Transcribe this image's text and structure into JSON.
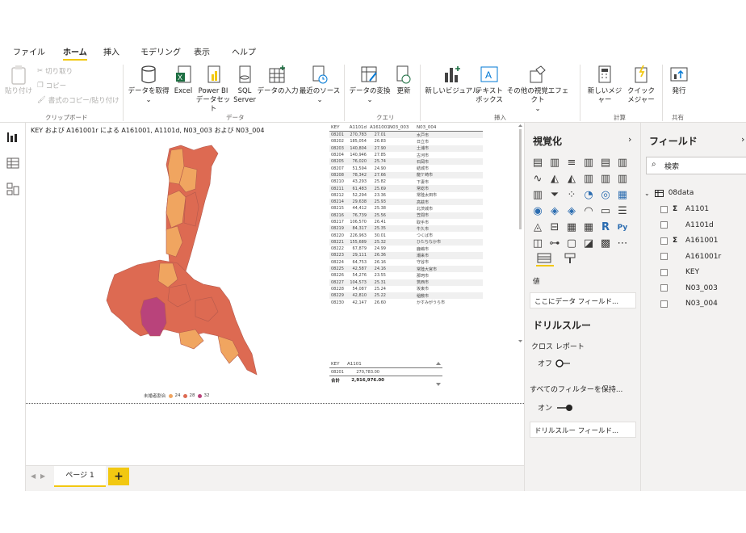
{
  "tabs": [
    "ファイル",
    "ホーム",
    "挿入",
    "モデリング",
    "表示",
    "ヘルプ"
  ],
  "active_tab": "ホーム",
  "ribbon": {
    "clipboard": {
      "paste": "貼り付け",
      "cut": "切り取り",
      "copy": "コピー",
      "format_painter": "書式のコピー/貼り付け",
      "group": "クリップボード"
    },
    "data": {
      "get_data": "データを取得",
      "excel": "Excel",
      "powerbi": "Power BI データセット",
      "sql": "SQL Server",
      "enter_data": "データの入力",
      "recent": "最近のソース",
      "group": "データ"
    },
    "queries": {
      "transform": "データの変換",
      "refresh": "更新",
      "group": "クエリ"
    },
    "insert": {
      "new_visual": "新しいビジュアル",
      "textbox": "テキスト ボックス",
      "more_visuals": "その他の視覚エフェクト",
      "group": "挿入"
    },
    "calc": {
      "new_measure": "新しいメジャー",
      "quick_measure": "クイック メジャー",
      "group": "計算"
    },
    "share": {
      "publish": "発行",
      "group": "共有"
    }
  },
  "visual_title": "KEY および A161001r による A161001, A1101d, N03_003 および N03_004",
  "legend": {
    "title": "未婚者割合",
    "items": [
      {
        "label": "24",
        "color": "#f0a560"
      },
      {
        "label": "28",
        "color": "#dd6a52"
      },
      {
        "label": "32",
        "color": "#b9437b"
      }
    ]
  },
  "table1": {
    "headers": [
      "KEY",
      "A1101d",
      "A161001",
      "N03_003",
      "N03_004"
    ],
    "rows": [
      [
        "08201",
        "270,783",
        "27.01",
        "",
        "水戸市"
      ],
      [
        "08202",
        "185,054",
        "26.83",
        "",
        "日立市"
      ],
      [
        "08203",
        "140,804",
        "27.90",
        "",
        "土浦市"
      ],
      [
        "08204",
        "140,946",
        "27.85",
        "",
        "古河市"
      ],
      [
        "08205",
        "76,020",
        "25.74",
        "",
        "石岡市"
      ],
      [
        "08207",
        "51,594",
        "24.90",
        "",
        "結城市"
      ],
      [
        "08208",
        "78,342",
        "27.66",
        "",
        "龍ケ崎市"
      ],
      [
        "08210",
        "43,293",
        "25.82",
        "",
        "下妻市"
      ],
      [
        "08211",
        "61,483",
        "25.69",
        "",
        "常総市"
      ],
      [
        "08212",
        "52,294",
        "23.36",
        "",
        "常陸太田市"
      ],
      [
        "08214",
        "29,638",
        "25.93",
        "",
        "高萩市"
      ],
      [
        "08215",
        "44,412",
        "25.38",
        "",
        "北茨城市"
      ],
      [
        "08216",
        "76,739",
        "25.56",
        "",
        "笠間市"
      ],
      [
        "08217",
        "106,570",
        "26.41",
        "",
        "取手市"
      ],
      [
        "08219",
        "84,317",
        "25.35",
        "",
        "牛久市"
      ],
      [
        "08220",
        "226,963",
        "30.01",
        "",
        "つくば市"
      ],
      [
        "08221",
        "155,689",
        "25.32",
        "",
        "ひたちなか市"
      ],
      [
        "08222",
        "67,879",
        "24.99",
        "",
        "鹿嶋市"
      ],
      [
        "08223",
        "29,111",
        "26.36",
        "",
        "潮来市"
      ],
      [
        "08224",
        "64,753",
        "26.16",
        "",
        "守谷市"
      ],
      [
        "08225",
        "42,587",
        "24.16",
        "",
        "常陸大宮市"
      ],
      [
        "08226",
        "54,276",
        "23.55",
        "",
        "那珂市"
      ],
      [
        "08227",
        "104,573",
        "25.31",
        "",
        "筑西市"
      ],
      [
        "08228",
        "54,087",
        "25.24",
        "",
        "坂東市"
      ],
      [
        "08229",
        "42,810",
        "25.22",
        "",
        "稲敷市"
      ],
      [
        "08230",
        "42,147",
        "26.60",
        "",
        "かすみがうら市"
      ]
    ]
  },
  "table2": {
    "headers": [
      "KEY",
      "A1101"
    ],
    "rows": [
      [
        "08201",
        "270,783.00"
      ]
    ],
    "total_label": "合計",
    "total_value": "2,916,976.00"
  },
  "page_tab": "ページ 1",
  "add_page": "+",
  "viz_pane": {
    "title": "視覚化",
    "values_label": "値",
    "values_placeholder": "ここにデータ フィールド...",
    "drill_title": "ドリルスルー",
    "cross_report": "クロス レポート",
    "cross_state": "オフ",
    "keep_filters": "すべてのフィルターを保持...",
    "keep_state": "オン",
    "drill_placeholder": "ドリルスルー フィールド..."
  },
  "fields_pane": {
    "title": "フィールド",
    "search_placeholder": "検索",
    "table_name": "08data",
    "fields": [
      {
        "name": "A1101",
        "sigma": true
      },
      {
        "name": "A1101d",
        "sigma": false
      },
      {
        "name": "A161001",
        "sigma": true
      },
      {
        "name": "A161001r",
        "sigma": false
      },
      {
        "name": "KEY",
        "sigma": false
      },
      {
        "name": "N03_003",
        "sigma": false
      },
      {
        "name": "N03_004",
        "sigma": false
      }
    ]
  }
}
